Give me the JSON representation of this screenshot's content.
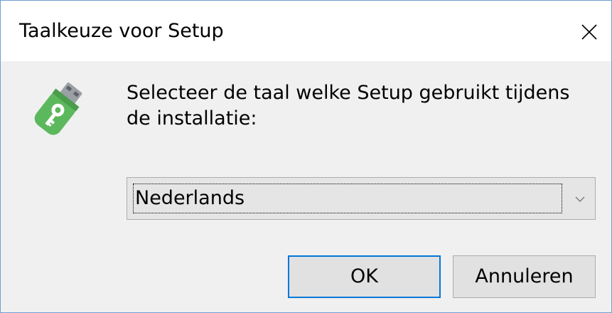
{
  "window": {
    "title": "Taalkeuze voor Setup",
    "close_icon": "close-icon"
  },
  "icon": "setup-usb-key-icon",
  "message": "Selecteer de taal welke Setup gebruikt tijdens de installatie:",
  "language_select": {
    "selected": "Nederlands",
    "arrow_icon": "chevron-down-icon"
  },
  "buttons": {
    "ok": "OK",
    "cancel": "Annuleren"
  },
  "colors": {
    "accent": "#0078d7",
    "icon_green": "#5cb85c"
  }
}
